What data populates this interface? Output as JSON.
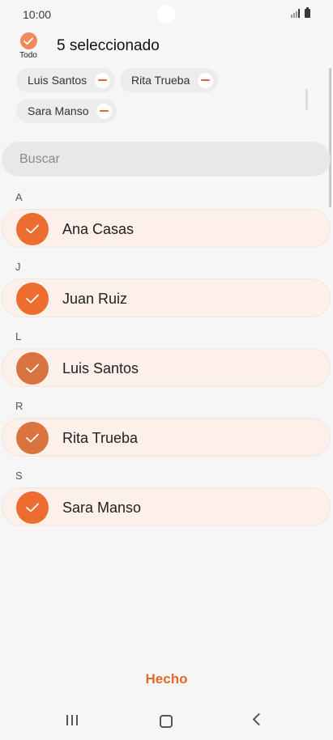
{
  "status_bar": {
    "time": "10:00"
  },
  "header": {
    "select_all_label": "Todo",
    "selected_title": "5 seleccionado"
  },
  "chips": [
    {
      "label": "Luis Santos"
    },
    {
      "label": "Rita Trueba"
    },
    {
      "label": "Sara Manso"
    }
  ],
  "search": {
    "placeholder": "Buscar"
  },
  "sections": [
    {
      "letter": "A",
      "contacts": [
        {
          "name": "Ana Casas",
          "color": "#ec6d2f",
          "checked": true
        }
      ]
    },
    {
      "letter": "J",
      "contacts": [
        {
          "name": "Juan Ruiz",
          "color": "#ec6d2f",
          "checked": true
        }
      ]
    },
    {
      "letter": "L",
      "contacts": [
        {
          "name": "Luis Santos",
          "color": "#d9733f",
          "checked": true
        }
      ]
    },
    {
      "letter": "R",
      "contacts": [
        {
          "name": "Rita Trueba",
          "color": "#d9733f",
          "checked": true
        }
      ]
    },
    {
      "letter": "S",
      "contacts": [
        {
          "name": "Sara Manso",
          "color": "#ec6d2f",
          "checked": true
        }
      ]
    }
  ],
  "footer": {
    "done_label": "Hecho"
  },
  "colors": {
    "accent": "#e06a2c",
    "row_background": "#fdf0ea"
  },
  "icons": {
    "check": "check-icon",
    "remove": "minus-icon",
    "nav_recent": "recent-apps-icon",
    "nav_home": "home-icon",
    "nav_back": "back-icon"
  }
}
